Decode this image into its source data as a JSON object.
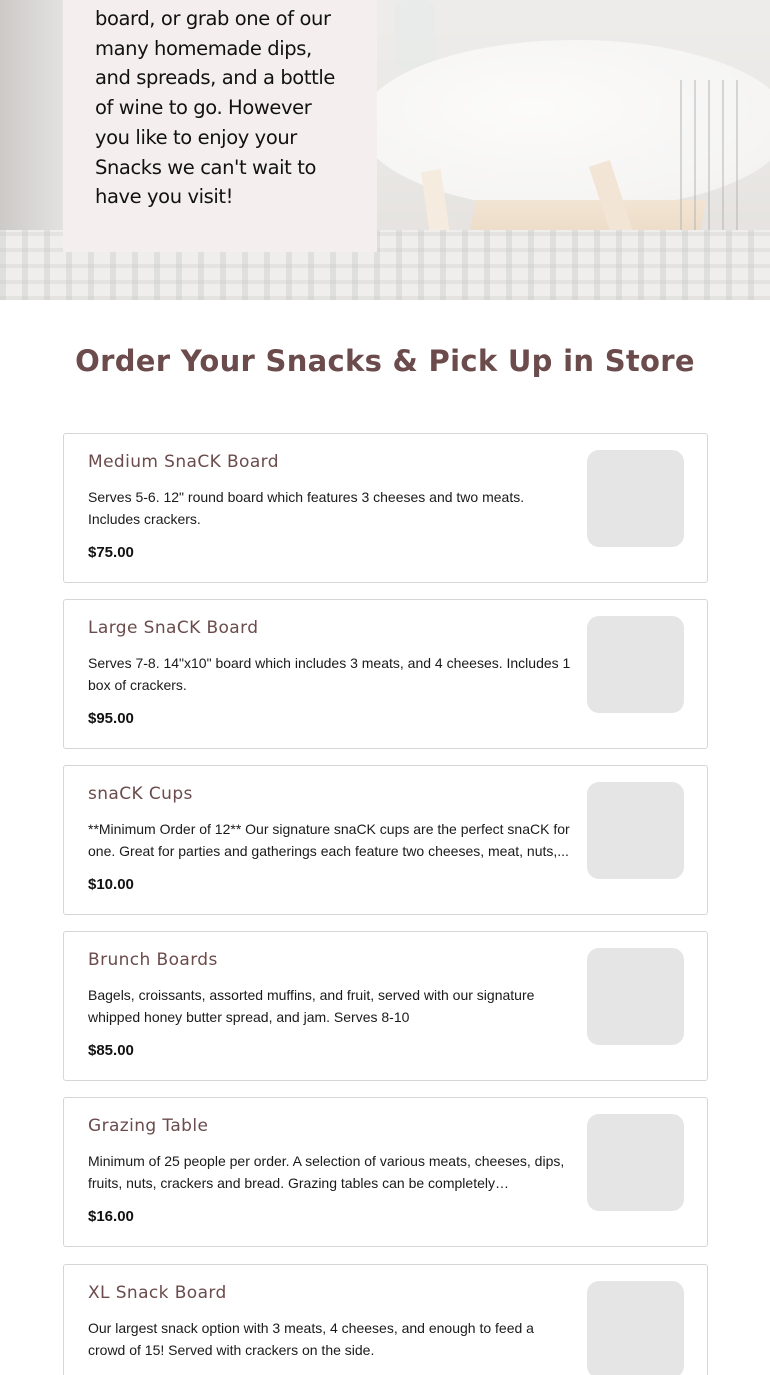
{
  "hero": {
    "intro_text": "board, or grab one of our many homemade dips, and spreads, and a bottle of wine to go. However you like to enjoy your Snacks we can't wait to have you visit!"
  },
  "section": {
    "title": "Order Your Snacks & Pick Up in Store"
  },
  "menu_items": [
    {
      "name": "Medium SnaCK Board",
      "description": "Serves 5-6. 12\" round board which features 3 cheeses and two meats. Includes crackers.",
      "price": "$75.00"
    },
    {
      "name": "Large SnaCK Board",
      "description": "Serves 7-8. 14\"x10\" board which includes 3 meats, and 4 cheeses. Includes 1 box of crackers.",
      "price": "$95.00"
    },
    {
      "name": "snaCK Cups",
      "description": "**Minimum Order of 12** Our signature snaCK cups are the perfect snaCK for one. Great for parties and gatherings each feature two cheeses, meat, nuts,...",
      "price": "$10.00"
    },
    {
      "name": "Brunch Boards",
      "description": "Bagels, croissants, assorted muffins, and fruit, served with our signature whipped honey butter spread, and jam. Serves 8-10",
      "price": "$85.00"
    },
    {
      "name": "Grazing Table",
      "description": "Minimum of 25 people per order. A selection of various meats, cheeses, dips, fruits, nuts, crackers and bread. Grazing tables can be completely customizabl...",
      "price": "$16.00"
    },
    {
      "name": "XL Snack Board",
      "description": "Our largest snack option with 3 meats, 4 cheeses, and enough to feed a crowd of 15! Served with crackers on the side.",
      "price": ""
    }
  ]
}
